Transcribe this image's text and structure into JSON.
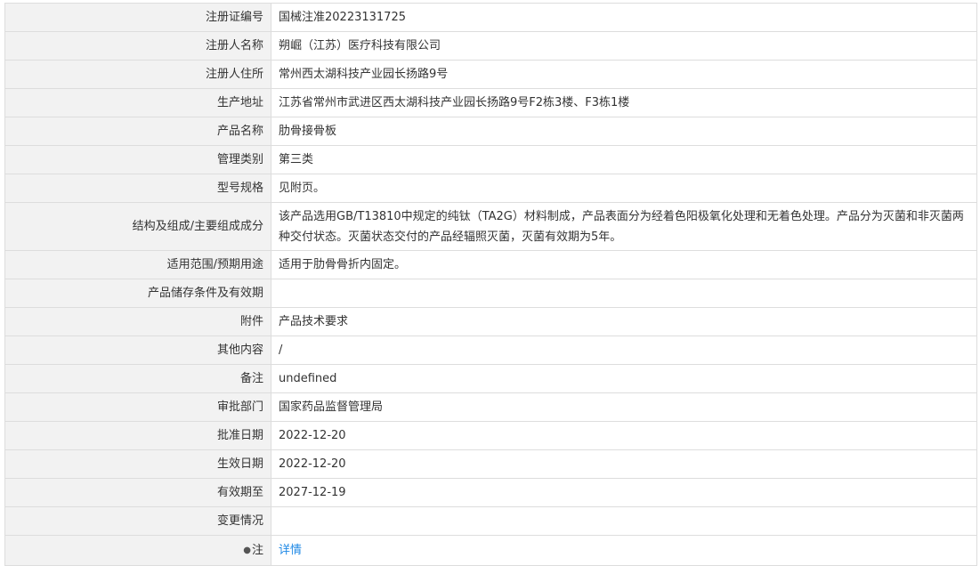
{
  "rows": [
    {
      "label": "注册证编号",
      "value": "国械注准20223131725"
    },
    {
      "label": "注册人名称",
      "value": "朔崛（江苏）医疗科技有限公司"
    },
    {
      "label": "注册人住所",
      "value": "常州西太湖科技产业园长扬路9号"
    },
    {
      "label": "生产地址",
      "value": "江苏省常州市武进区西太湖科技产业园长扬路9号F2栋3楼、F3栋1楼"
    },
    {
      "label": "产品名称",
      "value": "肋骨接骨板"
    },
    {
      "label": "管理类别",
      "value": "第三类"
    },
    {
      "label": "型号规格",
      "value": "见附页。"
    },
    {
      "label": "结构及组成/主要组成成分",
      "value": "该产品选用GB/T13810中规定的纯钛（TA2G）材料制成，产品表面分为经着色阳极氧化处理和无着色处理。产品分为灭菌和非灭菌两种交付状态。灭菌状态交付的产品经辐照灭菌，灭菌有效期为5年。"
    },
    {
      "label": "适用范围/预期用途",
      "value": "适用于肋骨骨折内固定。"
    },
    {
      "label": "产品储存条件及有效期",
      "value": ""
    },
    {
      "label": "附件",
      "value": "产品技术要求"
    },
    {
      "label": "其他内容",
      "value": "/"
    },
    {
      "label": "备注",
      "value": "undefined"
    },
    {
      "label": "审批部门",
      "value": "国家药品监督管理局"
    },
    {
      "label": "批准日期",
      "value": "2022-12-20"
    },
    {
      "label": "生效日期",
      "value": "2022-12-20"
    },
    {
      "label": "有效期至",
      "value": "2027-12-19"
    },
    {
      "label": "变更情况",
      "value": ""
    }
  ],
  "note": {
    "icon": "lightbulb-icon",
    "label": "注",
    "link_text": "详情",
    "link_color": "#1e88e5"
  },
  "colors": {
    "label_bg": "#f2f2f2",
    "border": "#dddddd",
    "text": "#333333"
  }
}
